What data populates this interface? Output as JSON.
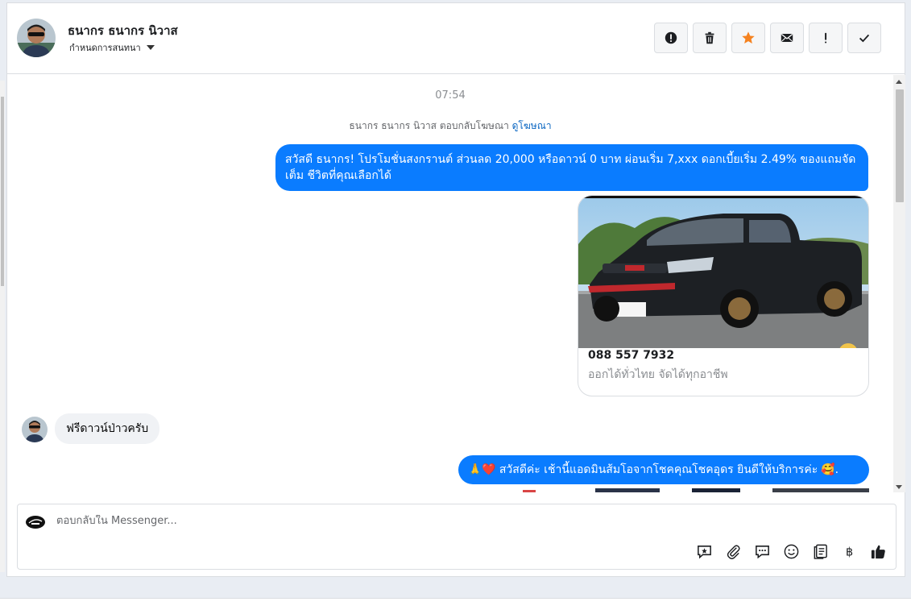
{
  "header": {
    "contact_name": "ธนากร ธนากร นิวาส",
    "assign_label": "กำหนดการสนทนา",
    "actions": [
      {
        "name": "spam-button",
        "icon": "alert-circle-icon"
      },
      {
        "name": "delete-button",
        "icon": "trash-icon"
      },
      {
        "name": "star-button",
        "icon": "star-icon",
        "color": "#f5821f"
      },
      {
        "name": "mark-unread-button",
        "icon": "envelope-icon"
      },
      {
        "name": "follow-up-button",
        "icon": "exclamation-icon"
      },
      {
        "name": "mark-done-button",
        "icon": "checkmark-icon"
      }
    ]
  },
  "thread": {
    "timestamp": "07:54",
    "reply_note": "ธนากร ธนากร นิวาส ตอบกลับโฆษณา",
    "reply_note_link": "ดูโฆษณา",
    "messages": {
      "out1": "สวัสดี ธนากร! โปรโมชั่นสงกรานต์ ส่วนลด 20,000 หรือดาวน์ 0 บาท ผ่อนเริ่ม 7,xxx ดอกเบี้ยเริ่ม 2.49% ของแถมจัดเต็ม ชีวิตที่คุณเลือกได้",
      "card_title": "088 557 7932",
      "card_subtitle": "ออกได้ทั่วไทย จัดได้ทุกอาชีพ",
      "in1": "ฟรีดาวน์ป่าวครับ",
      "out2_prefix": "🙏❤️",
      "out2": "สวัสดีค่ะ เช้านี้แอดมินส้มโอจากโชคคุณโชคอุดร ยินดีให้บริการค่ะ",
      "out2_suffix": "🥰."
    }
  },
  "composer": {
    "placeholder": "ตอบกลับใน Messenger...",
    "tools": [
      "saved-reply-icon",
      "attachment-icon",
      "chat-bubble-icon",
      "emoji-icon",
      "template-icon",
      "baht-icon",
      "thumbs-up-icon"
    ]
  },
  "colors": {
    "accent": "#0a7cff",
    "star": "#f5821f",
    "link": "#0a66c2"
  }
}
